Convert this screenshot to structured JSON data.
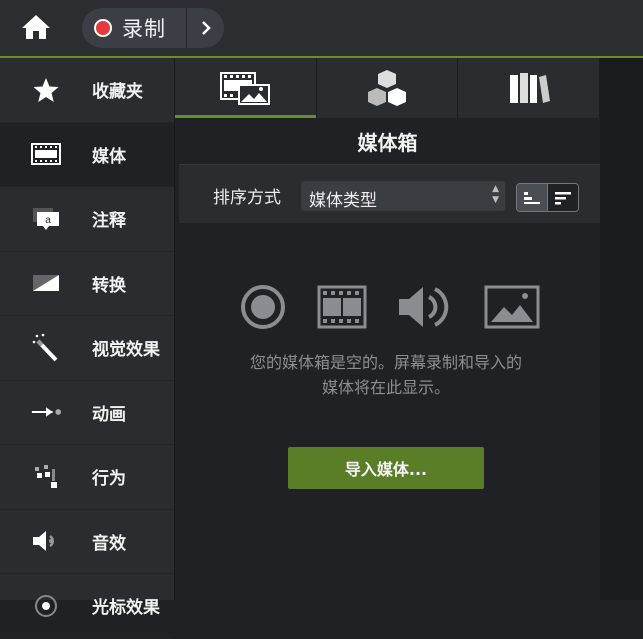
{
  "topbar": {
    "home_icon": "home-icon",
    "record_label": "录制",
    "record_color": "#e33b3b",
    "more_icon": "chevron-right-icon",
    "accent": "#6a8f2a"
  },
  "sidebar": {
    "items": [
      {
        "label": "收藏夹",
        "icon": "star-icon"
      },
      {
        "label": "媒体",
        "icon": "film-icon"
      },
      {
        "label": "注释",
        "icon": "annotation-icon"
      },
      {
        "label": "转换",
        "icon": "transition-icon"
      },
      {
        "label": "视觉效果",
        "icon": "magic-wand-icon"
      },
      {
        "label": "动画",
        "icon": "animation-arrow-icon"
      },
      {
        "label": "行为",
        "icon": "behavior-icon"
      },
      {
        "label": "音效",
        "icon": "audio-effect-icon"
      },
      {
        "label": "光标效果",
        "icon": "cursor-effect-icon"
      }
    ],
    "active_index": 1
  },
  "tabs": [
    {
      "icon": "media-bin-icon",
      "active": true
    },
    {
      "icon": "library-cubes-icon",
      "active": false
    },
    {
      "icon": "books-icon",
      "active": false
    }
  ],
  "panel": {
    "title": "媒体箱",
    "sort_label": "排序方式",
    "sort_value": "媒体类型",
    "empty_line1": "您的媒体箱是空的。屏幕录制和导入的",
    "empty_line2": "媒体将在此显示。",
    "import_label": "导入媒体...",
    "import_color": "#5a7d27"
  }
}
